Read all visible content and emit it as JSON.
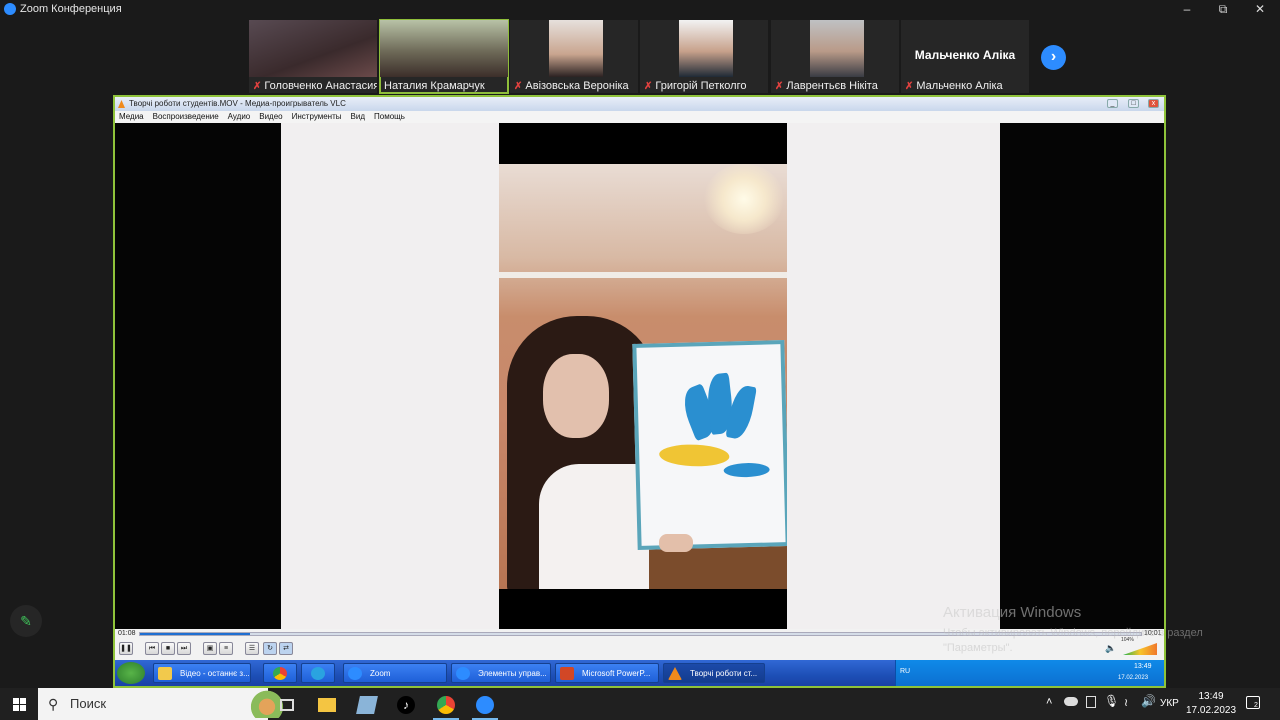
{
  "zoom": {
    "window_title": "Zoom Конференция",
    "participants": [
      {
        "name": "Головченко Анастасия",
        "muted": true
      },
      {
        "name": "Наталия Крамарчук",
        "muted": false,
        "active_speaker": true
      },
      {
        "name": "Авізовська Вероніка",
        "muted": true
      },
      {
        "name": "Григорій Петколго",
        "muted": true
      },
      {
        "name": "Лаврентьєв Нікіта",
        "muted": true
      },
      {
        "name": "Мальченко Аліка",
        "muted": true,
        "display_name": "Мальченко Аліка"
      }
    ],
    "next_page_icon": "chevron-right-icon",
    "annotate_icon": "pencil-icon",
    "accent": "#2d8cff"
  },
  "vlc": {
    "title": "Творчі роботи студентів.MOV - Медиа-проигрыватель VLC",
    "menu": [
      "Медиа",
      "Воспроизведение",
      "Аудио",
      "Видео",
      "Инструменты",
      "Вид",
      "Помощь"
    ],
    "time_elapsed": "01:08",
    "time_total": "10:01",
    "progress": 0.11,
    "volume_label": "104%"
  },
  "xp_taskbar": {
    "tasks": [
      "Відео - останнє з...",
      "",
      "",
      "Zoom",
      "Элементы управ...",
      "Microsoft PowerP...",
      "Творчі роботи ст..."
    ],
    "lang": "RU",
    "clock_time": "13:49",
    "clock_date": "17.02.2023"
  },
  "activation": {
    "title": "Активация Windows",
    "line1": "Чтобы активировать Windows, перейдите в раздел",
    "line2": "\"Параметры\"."
  },
  "taskbar": {
    "search_placeholder": "Поиск",
    "lang": "УКР",
    "time": "13:49",
    "date": "17.02.2023",
    "notifications": "2"
  }
}
